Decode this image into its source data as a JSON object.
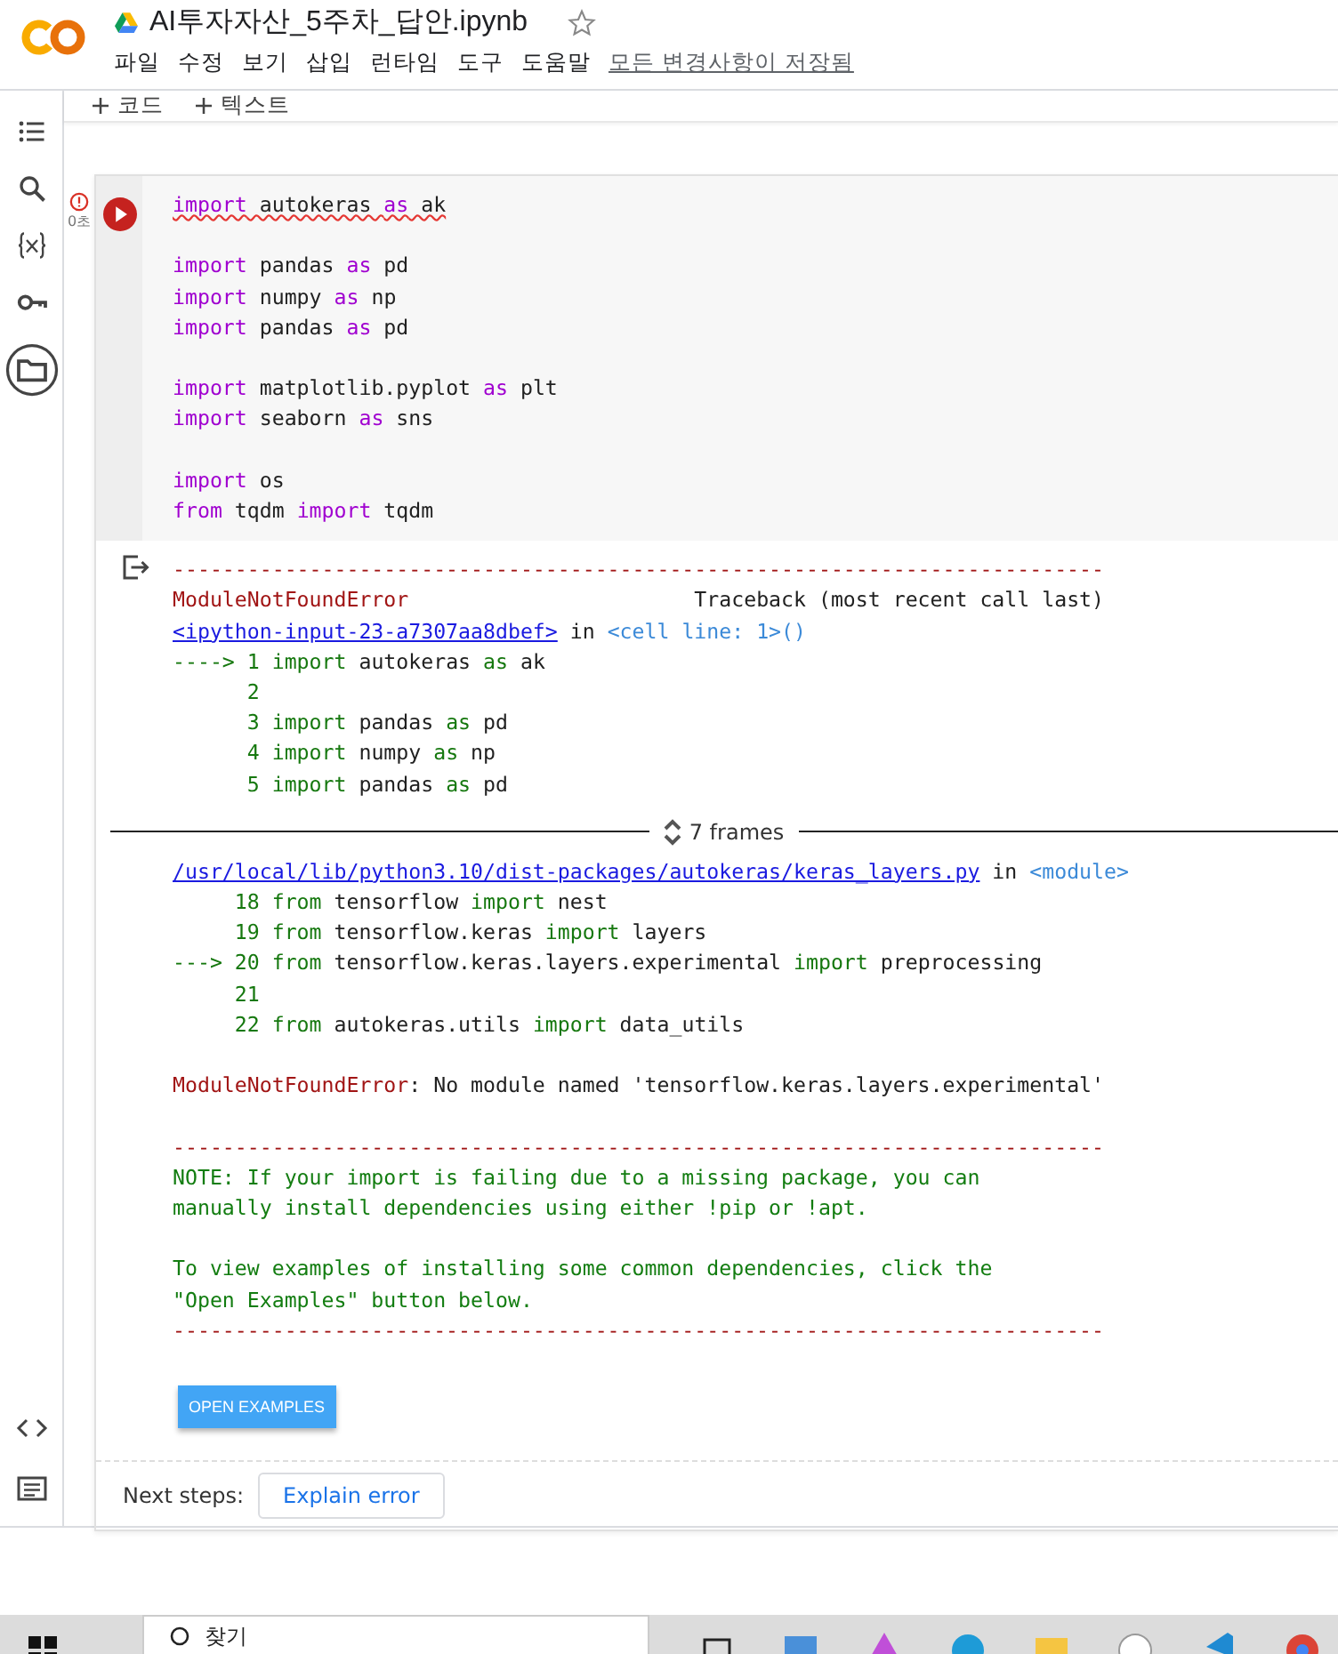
{
  "header": {
    "title": "AI투자자산_5주차_답안.ipynb",
    "menu": [
      "파일",
      "수정",
      "보기",
      "삽입",
      "런타임",
      "도구",
      "도움말"
    ],
    "save_status": "모든 변경사항이 저장됨"
  },
  "toolbar": {
    "buttons": [
      "코드",
      "텍스트"
    ]
  },
  "cell": {
    "exec_time": "0초",
    "lines": [
      {
        "squiggle": true,
        "gap_before": false,
        "segs": [
          {
            "text": "import",
            "kind": "kw"
          },
          {
            "text": " autokeras ",
            "kind": "plain"
          },
          {
            "text": "as",
            "kind": "kw"
          },
          {
            "text": " ak",
            "kind": "plain"
          }
        ]
      },
      {
        "squiggle": false,
        "gap_before": true,
        "segs": [
          {
            "text": "import",
            "kind": "kw"
          },
          {
            "text": " pandas ",
            "kind": "plain"
          },
          {
            "text": "as",
            "kind": "kw"
          },
          {
            "text": " pd",
            "kind": "plain"
          }
        ]
      },
      {
        "squiggle": false,
        "gap_before": false,
        "segs": [
          {
            "text": "import",
            "kind": "kw"
          },
          {
            "text": " numpy ",
            "kind": "plain"
          },
          {
            "text": "as",
            "kind": "kw"
          },
          {
            "text": " np",
            "kind": "plain"
          }
        ]
      },
      {
        "squiggle": false,
        "gap_before": false,
        "segs": [
          {
            "text": "import",
            "kind": "kw"
          },
          {
            "text": " pandas ",
            "kind": "plain"
          },
          {
            "text": "as",
            "kind": "kw"
          },
          {
            "text": " pd",
            "kind": "plain"
          }
        ]
      },
      {
        "squiggle": false,
        "gap_before": true,
        "segs": [
          {
            "text": "import",
            "kind": "kw"
          },
          {
            "text": " matplotlib.pyplot ",
            "kind": "plain"
          },
          {
            "text": "as",
            "kind": "kw"
          },
          {
            "text": " plt",
            "kind": "plain"
          }
        ]
      },
      {
        "squiggle": false,
        "gap_before": false,
        "segs": [
          {
            "text": "import",
            "kind": "kw"
          },
          {
            "text": " seaborn ",
            "kind": "plain"
          },
          {
            "text": "as",
            "kind": "kw"
          },
          {
            "text": " sns",
            "kind": "plain"
          }
        ]
      },
      {
        "squiggle": false,
        "gap_before": true,
        "segs": [
          {
            "text": "import",
            "kind": "kw"
          },
          {
            "text": " os",
            "kind": "plain"
          }
        ]
      },
      {
        "squiggle": false,
        "gap_before": false,
        "segs": [
          {
            "text": "from",
            "kind": "kw"
          },
          {
            "text": " tqdm ",
            "kind": "plain"
          },
          {
            "text": "import",
            "kind": "kw"
          },
          {
            "text": " tqdm",
            "kind": "plain"
          }
        ]
      }
    ]
  },
  "output": {
    "traceback": [
      {
        "segs": [
          {
            "text": "---------------------------------------------------------------------------",
            "kind": "err"
          }
        ]
      },
      {
        "segs": [
          {
            "text": "ModuleNotFoundError",
            "kind": "err"
          },
          {
            "text": "                       Traceback (most recent call last)",
            "kind": "plain"
          }
        ]
      },
      {
        "segs": [
          {
            "text": "<ipython-input-23-a7307aa8dbef>",
            "kind": "link"
          },
          {
            "text": " in ",
            "kind": "plain"
          },
          {
            "text": "<cell line: 1>()",
            "kind": "loc"
          }
        ]
      },
      {
        "segs": [
          {
            "text": "----> 1 import",
            "kind": "green"
          },
          {
            "text": " autokeras ",
            "kind": "plain"
          },
          {
            "text": "as",
            "kind": "green"
          },
          {
            "text": " ak",
            "kind": "plain"
          }
        ]
      },
      {
        "segs": [
          {
            "text": "      2",
            "kind": "green"
          }
        ]
      },
      {
        "segs": [
          {
            "text": "      3 import",
            "kind": "green"
          },
          {
            "text": " pandas ",
            "kind": "plain"
          },
          {
            "text": "as",
            "kind": "green"
          },
          {
            "text": " pd",
            "kind": "plain"
          }
        ]
      },
      {
        "segs": [
          {
            "text": "      4 import",
            "kind": "green"
          },
          {
            "text": " numpy ",
            "kind": "plain"
          },
          {
            "text": "as",
            "kind": "green"
          },
          {
            "text": " np",
            "kind": "plain"
          }
        ]
      },
      {
        "segs": [
          {
            "text": "      5 import",
            "kind": "green"
          },
          {
            "text": " pandas ",
            "kind": "plain"
          },
          {
            "text": "as",
            "kind": "green"
          },
          {
            "text": " pd",
            "kind": "plain"
          }
        ]
      }
    ],
    "frames_label": "7 frames",
    "frames": [
      {
        "gap_before": false,
        "segs": [
          {
            "text": "/usr/local/lib/python3.10/dist-packages/autokeras/keras_layers.py",
            "kind": "link"
          },
          {
            "text": " in ",
            "kind": "plain"
          },
          {
            "text": "<module>",
            "kind": "loc"
          }
        ]
      },
      {
        "gap_before": false,
        "segs": [
          {
            "text": "     18 from",
            "kind": "green"
          },
          {
            "text": " tensorflow ",
            "kind": "plain"
          },
          {
            "text": "import",
            "kind": "green"
          },
          {
            "text": " nest",
            "kind": "plain"
          }
        ]
      },
      {
        "gap_before": false,
        "segs": [
          {
            "text": "     19 from",
            "kind": "green"
          },
          {
            "text": " tensorflow.keras ",
            "kind": "plain"
          },
          {
            "text": "import",
            "kind": "green"
          },
          {
            "text": " layers",
            "kind": "plain"
          }
        ]
      },
      {
        "gap_before": false,
        "segs": [
          {
            "text": "---> 20 from",
            "kind": "green"
          },
          {
            "text": " tensorflow.keras.layers.experimental ",
            "kind": "plain"
          },
          {
            "text": "import",
            "kind": "green"
          },
          {
            "text": " preprocessing",
            "kind": "plain"
          }
        ]
      },
      {
        "gap_before": false,
        "segs": [
          {
            "text": "     21",
            "kind": "green"
          }
        ]
      },
      {
        "gap_before": false,
        "segs": [
          {
            "text": "     22 from",
            "kind": "green"
          },
          {
            "text": " autokeras.utils ",
            "kind": "plain"
          },
          {
            "text": "import",
            "kind": "green"
          },
          {
            "text": " data_utils",
            "kind": "plain"
          }
        ]
      },
      {
        "gap_before": true,
        "segs": [
          {
            "text": "ModuleNotFoundError",
            "kind": "err"
          },
          {
            "text": ": No module named 'tensorflow.keras.layers.experimental'",
            "kind": "plain"
          }
        ]
      },
      {
        "gap_before": true,
        "segs": [
          {
            "text": "---------------------------------------------------------------------------",
            "kind": "err"
          }
        ]
      },
      {
        "gap_before": false,
        "segs": [
          {
            "text": "NOTE: If your import is failing due to a missing package, you can",
            "kind": "note"
          }
        ]
      },
      {
        "gap_before": false,
        "segs": [
          {
            "text": "manually install dependencies using either !pip or !apt.",
            "kind": "note"
          }
        ]
      },
      {
        "gap_before": true,
        "segs": [
          {
            "text": "To view examples of installing some common dependencies, click the",
            "kind": "note"
          }
        ]
      },
      {
        "gap_before": false,
        "segs": [
          {
            "text": "\"Open Examples\" button below.",
            "kind": "note"
          }
        ]
      },
      {
        "gap_before": false,
        "segs": [
          {
            "text": "---------------------------------------------------------------------------",
            "kind": "err"
          }
        ]
      }
    ],
    "examples_button": "OPEN EXAMPLES",
    "next_steps_label": "Next steps:",
    "explain_button": "Explain error"
  },
  "taskbar": {
    "search_placeholder": "찾기"
  }
}
